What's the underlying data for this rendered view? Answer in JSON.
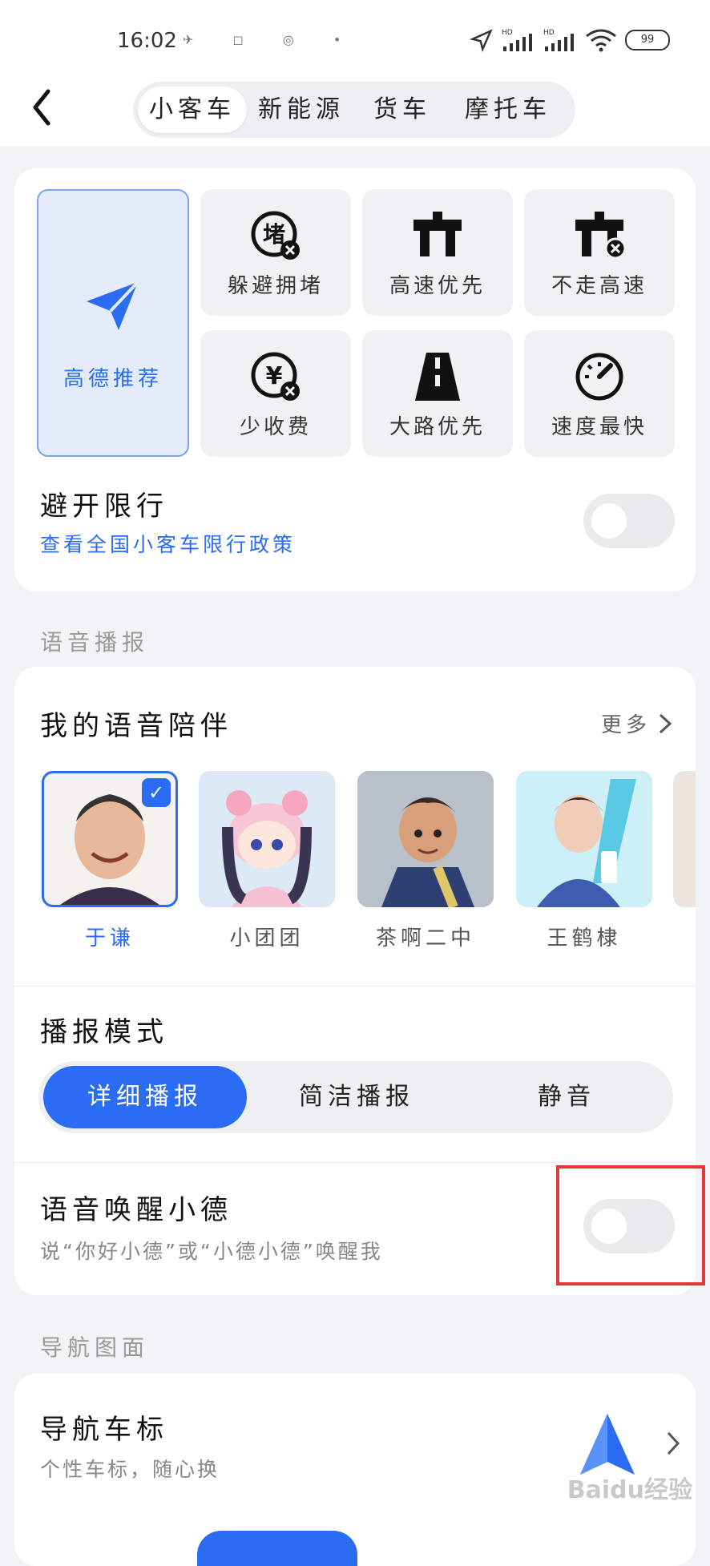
{
  "status_bar": {
    "time": "16:02",
    "icons": [
      "location-icon",
      "hd-signal-icon",
      "hd-signal-icon",
      "wifi-icon"
    ],
    "battery": "99"
  },
  "header": {
    "tabs": [
      {
        "label": "小客车",
        "active": true
      },
      {
        "label": "新能源",
        "active": false
      },
      {
        "label": "货车",
        "active": false
      },
      {
        "label": "摩托车",
        "active": false
      }
    ]
  },
  "route_prefs": {
    "recommended": "高德推荐",
    "options": [
      {
        "label": "躲避拥堵",
        "icon": "avoid-congestion-icon"
      },
      {
        "label": "高速优先",
        "icon": "highway-icon"
      },
      {
        "label": "不走高速",
        "icon": "no-highway-icon"
      },
      {
        "label": "少收费",
        "icon": "less-toll-icon"
      },
      {
        "label": "大路优先",
        "icon": "main-road-icon"
      },
      {
        "label": "速度最快",
        "icon": "speedometer-icon"
      }
    ],
    "restriction_title": "避开限行",
    "restriction_link": "查看全国小客车限行政策",
    "restriction_on": false
  },
  "voice_section": {
    "section_title": "语音播报",
    "companion_title": "我的语音陪伴",
    "more": "更多",
    "voices": [
      {
        "name": "于谦",
        "selected": true
      },
      {
        "name": "小团团",
        "selected": false
      },
      {
        "name": "茶啊二中",
        "selected": false
      },
      {
        "name": "王鹤棣",
        "selected": false
      }
    ],
    "mode_title": "播报模式",
    "modes": [
      {
        "label": "详细播报",
        "active": true
      },
      {
        "label": "简洁播报",
        "active": false
      },
      {
        "label": "静音",
        "active": false
      }
    ],
    "wake_title": "语音唤醒小德",
    "wake_desc": "说“你好小德”或“小德小德”唤醒我",
    "wake_on": false
  },
  "nav_section": {
    "section_title": "导航图面",
    "car_icon_title": "导航车标",
    "car_icon_desc": "个性车标，随心换"
  },
  "watermark": "Baidu经验",
  "colors": {
    "accent": "#2a6cf3",
    "highlight_box": "#e53935"
  }
}
